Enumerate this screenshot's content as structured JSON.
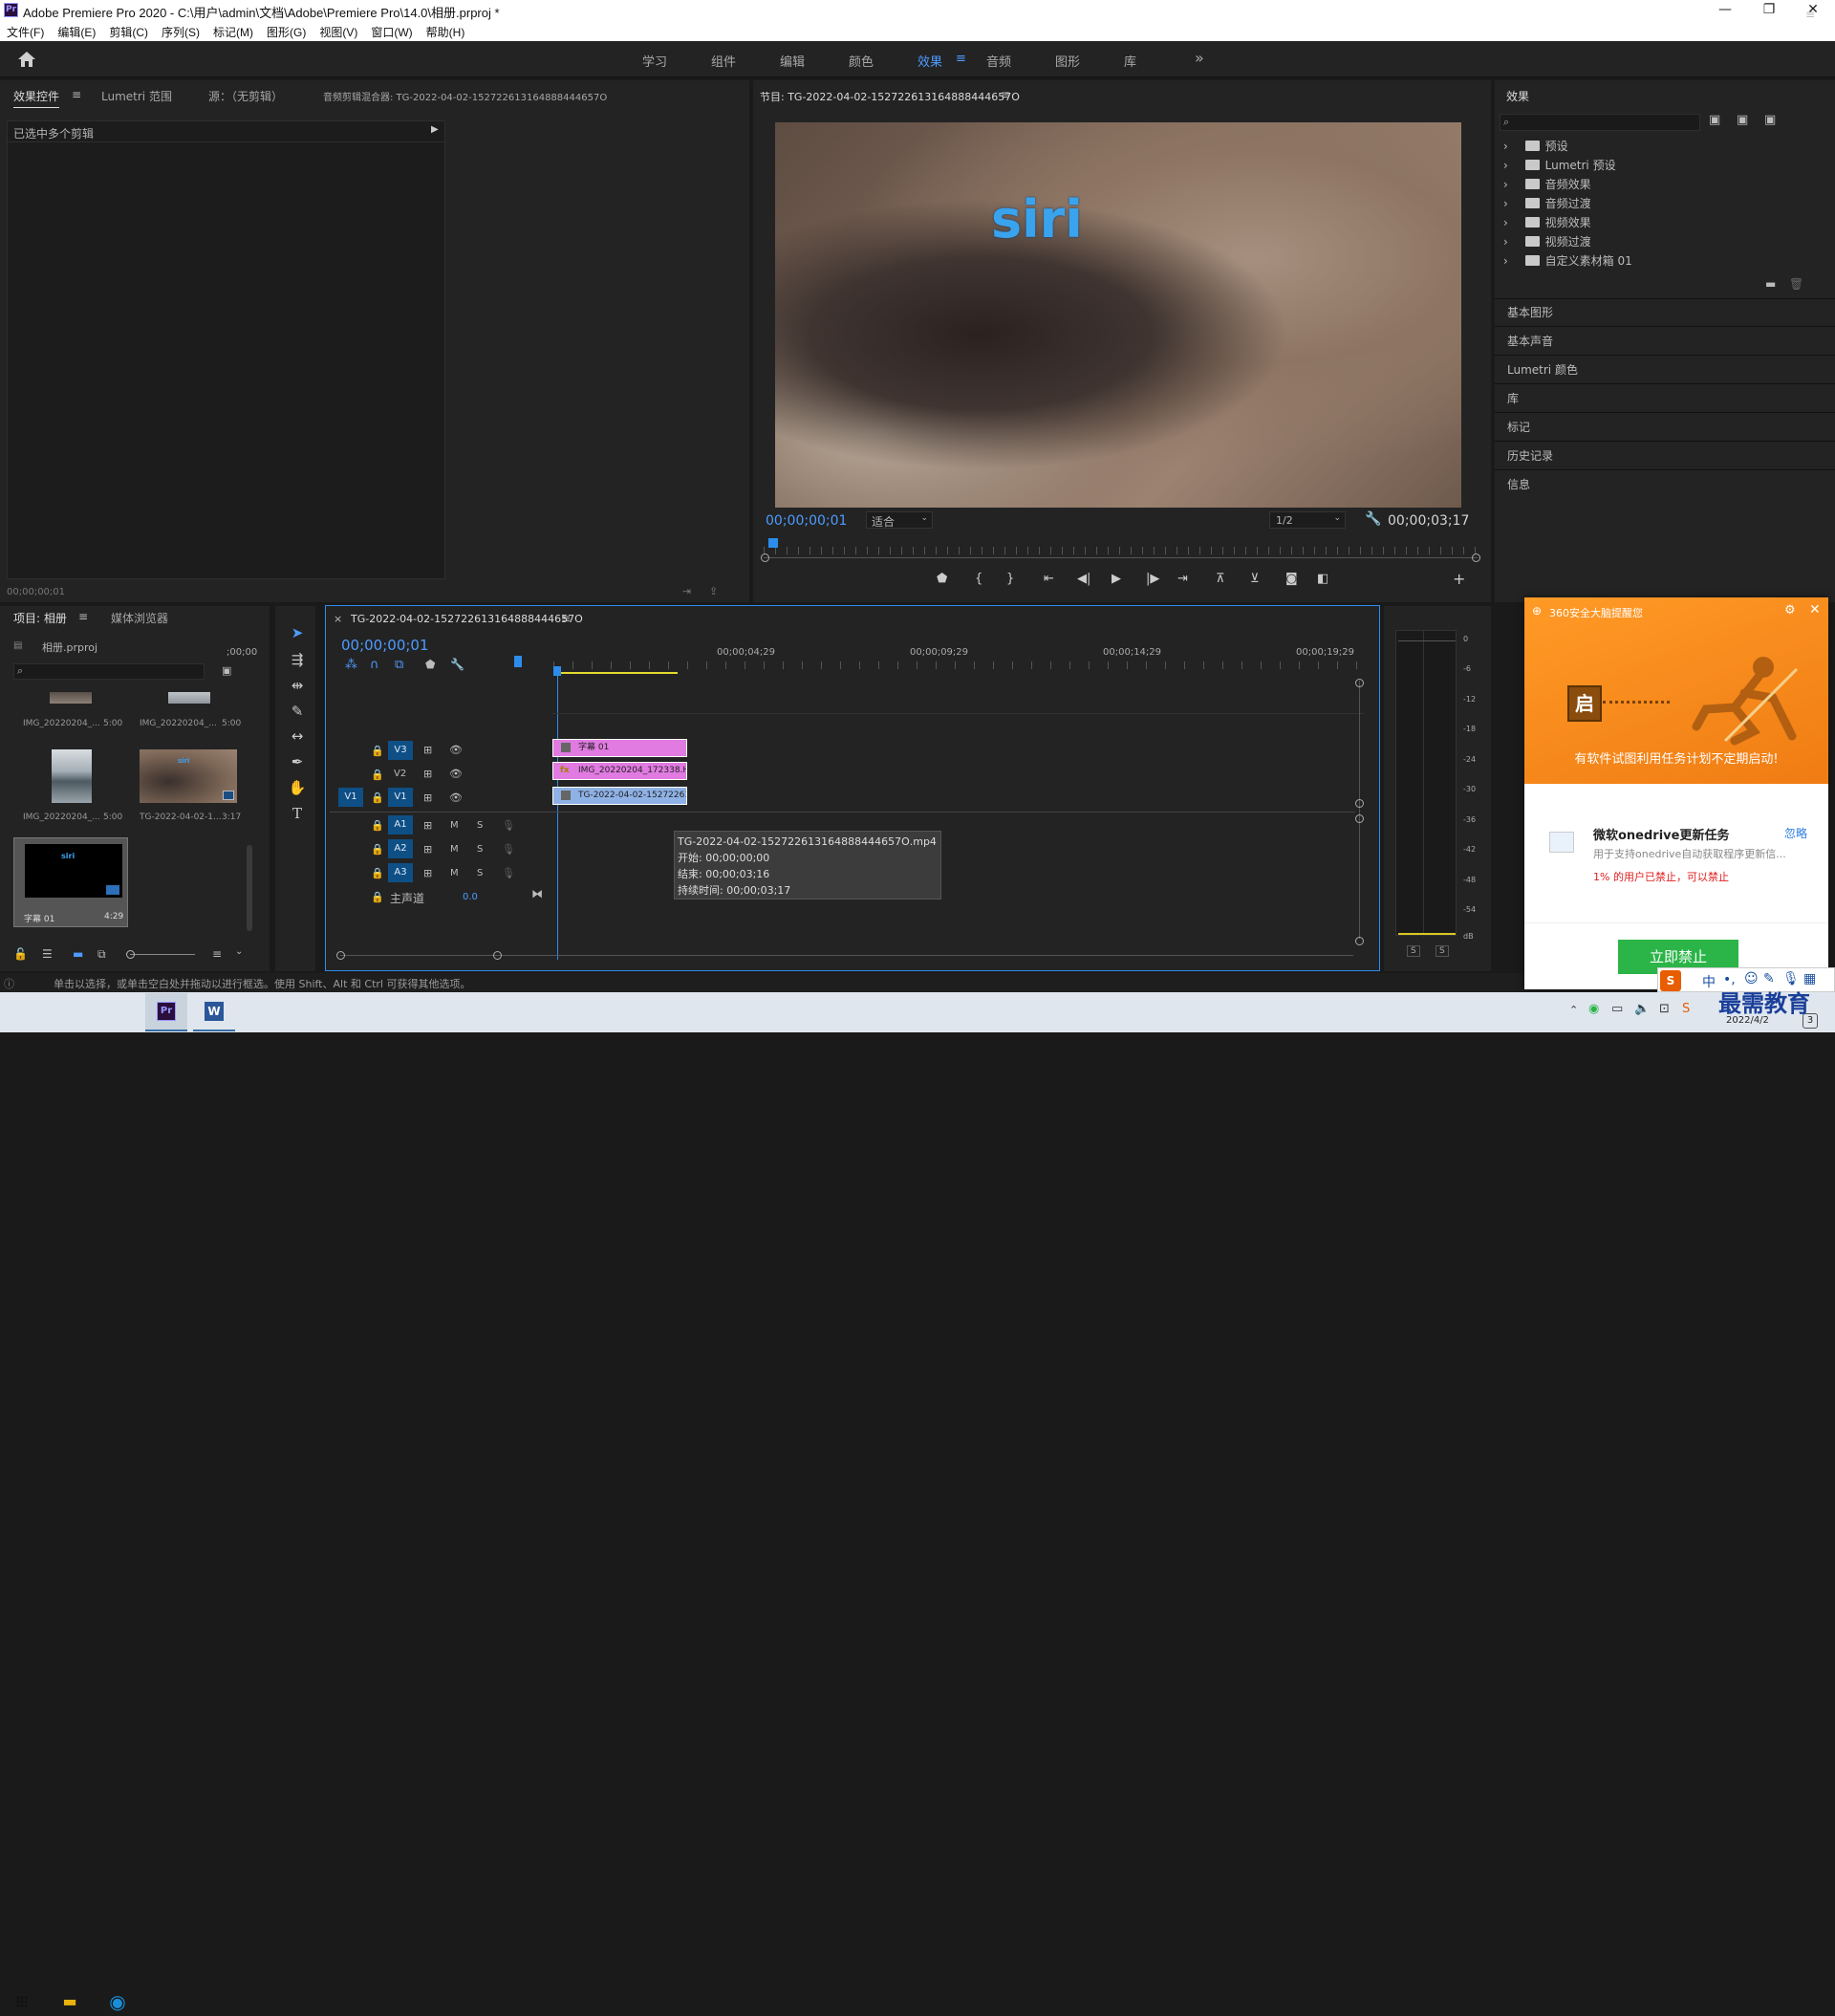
{
  "window": {
    "app_icon": "Pr",
    "title": "Adobe Premiere Pro 2020 - C:\\用户\\admin\\文档\\Adobe\\Premiere Pro\\14.0\\相册.prproj *",
    "minimize": "—",
    "restore": "❐",
    "close": "✕"
  },
  "menu": [
    "文件(F)",
    "编辑(E)",
    "剪辑(C)",
    "序列(S)",
    "标记(M)",
    "图形(G)",
    "视图(V)",
    "窗口(W)",
    "帮助(H)"
  ],
  "workspaces": {
    "items": [
      "学习",
      "组件",
      "编辑",
      "颜色",
      "效果",
      "音频",
      "图形",
      "库"
    ],
    "active": "效果",
    "more": "»"
  },
  "source_panel": {
    "tabs": [
      "效果控件",
      "Lumetri 范围",
      "源：（无剪辑）",
      "音频剪辑混合器: TG-2022-04-02-152722613164888444657О"
    ],
    "selected_text": "已选中多个剪辑",
    "timecode": "00;00;00;01"
  },
  "program_monitor": {
    "title": "节目: TG-2022-04-02-152722613164888444657О",
    "overlay_text": "siri",
    "timecode": "00;00;00;01",
    "fit": "适合",
    "resolution": "1/2",
    "duration": "00;00;03;17"
  },
  "effects_panel": {
    "title": "效果",
    "folders": [
      "预设",
      "Lumetri 预设",
      "音频效果",
      "音频过渡",
      "视频效果",
      "视频过渡",
      "自定义素材箱 01"
    ],
    "sections": [
      "基本图形",
      "基本声音",
      "Lumetri 颜色",
      "库",
      "标记",
      "历史记录",
      "信息"
    ]
  },
  "project_panel": {
    "tabs": [
      "项目: 相册",
      "媒体浏览器"
    ],
    "file": "相册.prproj",
    "items": [
      {
        "name": "IMG_20220204_...",
        "dur": "5:00"
      },
      {
        "name": "IMG_20220204_...",
        "dur": "5:00"
      },
      {
        "name": "IMG_20220204_...",
        "dur": "5:00"
      },
      {
        "name": "TG-2022-04-02-1...",
        "dur": "3:17"
      },
      {
        "name": "字幕 01",
        "dur": "4:29",
        "thumb_text": "siri"
      }
    ]
  },
  "timeline": {
    "sequence_name": "TG-2022-04-02-152722613164888444657О",
    "timecode": "00;00;00;01",
    "ruler": [
      ";00;00",
      "00;00;04;29",
      "00;00;09;29",
      "00;00;14;29",
      "00;00;19;29"
    ],
    "video_tracks": [
      "V3",
      "V2",
      "V1"
    ],
    "source_patch": "V1",
    "audio_tracks": [
      "A1",
      "A2",
      "A3"
    ],
    "master": {
      "label": "主声道",
      "value": "0.0"
    },
    "clips": [
      {
        "track": "V3",
        "label": "字幕 01",
        "color": "#e17ae1"
      },
      {
        "track": "V2",
        "label": "IMG_20220204_172338.H",
        "color": "#e17ae1",
        "badge": "fx"
      },
      {
        "track": "V1",
        "label": "TG-2022-04-02-152722613",
        "color": "#8fb2e6"
      }
    ],
    "tooltip": {
      "name": "TG-2022-04-02-152722613164888444657О.mp4",
      "start": "开始: 00;00;00;00",
      "end": "结束: 00;00;03;16",
      "duration": "持续时间: 00;00;03;17"
    }
  },
  "audio_meter": {
    "labels": [
      "0",
      "-6",
      "-12",
      "-18",
      "-24",
      "-30",
      "-36",
      "-42",
      "-48",
      "-54",
      "dB"
    ],
    "solo": [
      "S",
      "S"
    ]
  },
  "status_bar": {
    "text": "单击以选择，或单击空白处并拖动以进行框选。使用 Shift、Alt 和 Ctrl 可获得其他选项。"
  },
  "popup_360": {
    "header": "360安全大脑提醒您",
    "lock_char": "启",
    "headline": "有软件试图利用任务计划不定期启动!",
    "task_title": "微软onedrive更新任务",
    "ignore": "忽略",
    "desc": "用于支持onedrive自动获取程序更新信...",
    "stat_prefix": "1% 的用户已禁止，",
    "stat_link": "可以禁止",
    "button": "立即禁止"
  },
  "taskbar": {
    "pr_label": "Pr",
    "word_label": "W",
    "ime": "中",
    "date": "2022/4/2",
    "watermark": "最需教育",
    "notification_count": "3"
  }
}
